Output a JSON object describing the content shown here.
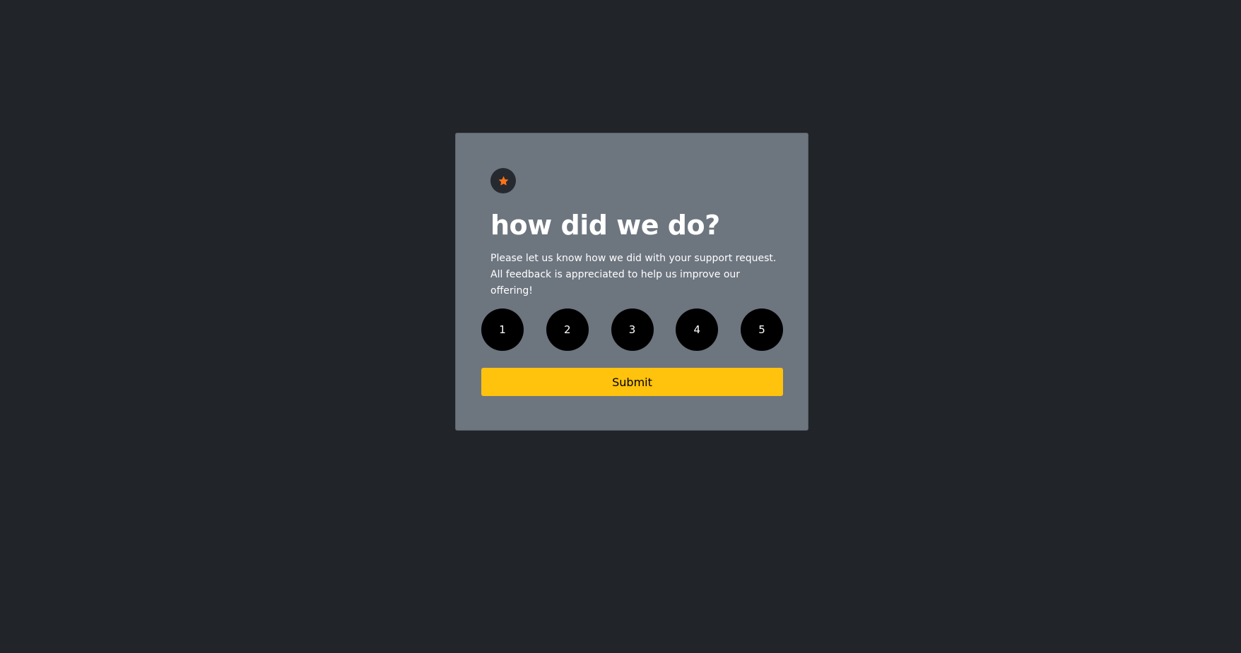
{
  "card": {
    "icon": "star-icon",
    "title": "how did we do?",
    "description": "Please let us know how we did with your support request. All feedback is appreciated to help us improve our offering!",
    "ratings": [
      "1",
      "2",
      "3",
      "4",
      "5"
    ],
    "submit_label": "Submit"
  },
  "colors": {
    "page_background": "#212428",
    "card_background": "#6d757f",
    "icon_badge": "#262a30",
    "star": "#f97316",
    "rating_button": "#000000",
    "submit_button": "#ffc20d"
  }
}
